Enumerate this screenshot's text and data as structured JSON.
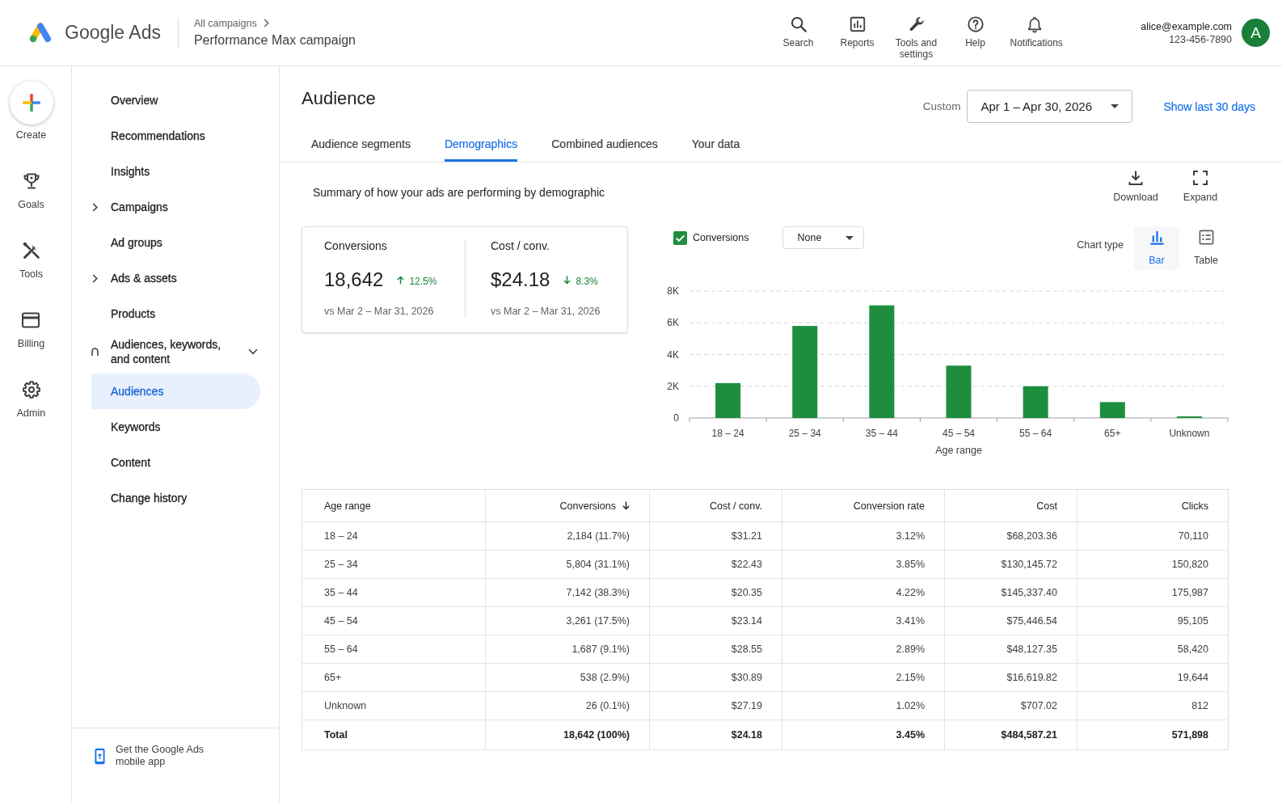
{
  "header": {
    "product_name": "Google Ads",
    "breadcrumb": {
      "parent": "All campaigns",
      "current": "Performance Max campaign"
    },
    "nav": [
      {
        "label": "Search"
      },
      {
        "label": "Reports"
      },
      {
        "label": "Tools and settings"
      },
      {
        "label": "Help"
      },
      {
        "label": "Notifications"
      }
    ],
    "account": {
      "email": "alice@example.com",
      "phone": "123-456-7890",
      "avatar_initial": "A"
    }
  },
  "rail": [
    {
      "label": "Create"
    },
    {
      "label": "Goals"
    },
    {
      "label": "Tools"
    },
    {
      "label": "Billing"
    },
    {
      "label": "Admin"
    }
  ],
  "sidebar": {
    "items": [
      {
        "kind": "link",
        "label": "Overview",
        "selected": false
      },
      {
        "kind": "link",
        "label": "Recommendations",
        "selected": false
      },
      {
        "kind": "link",
        "label": "Insights",
        "selected": false
      },
      {
        "kind": "group",
        "label": "Campaigns",
        "selected": false,
        "expanded": false
      },
      {
        "kind": "link",
        "label": "Ad groups",
        "selected": false
      },
      {
        "kind": "group",
        "label": "Ads & assets",
        "selected": false,
        "expanded": false
      },
      {
        "kind": "link",
        "label": "Products",
        "selected": false
      },
      {
        "kind": "group",
        "label": "Audiences, keywords, and content",
        "selected": false,
        "expanded": true,
        "children": [
          {
            "kind": "link",
            "label": "Audiences",
            "selected": true
          },
          {
            "kind": "link",
            "label": "Keywords",
            "selected": false
          },
          {
            "kind": "link",
            "label": "Content",
            "selected": false
          }
        ]
      },
      {
        "kind": "link",
        "label": "Change history",
        "selected": false
      }
    ],
    "promo": "Get the Google Ads mobile app"
  },
  "page": {
    "title": "Audience",
    "date_range": {
      "label": "Custom",
      "value": "Apr 1 – Apr 30, 2026"
    },
    "quick_range_link": "Show last 30 days",
    "tabs": [
      {
        "label": "Audience segments",
        "selected": false
      },
      {
        "label": "Demographics",
        "selected": true
      },
      {
        "label": "Combined audiences",
        "selected": false
      },
      {
        "label": "Your data",
        "selected": false
      }
    ],
    "summary_text": "Summary of how your ads are performing by demographic",
    "actions": [
      {
        "label": "Download"
      },
      {
        "label": "Expand"
      }
    ],
    "scorecards": [
      {
        "label": "Conversions",
        "value": "18,642",
        "increased": true,
        "change": "12.5%",
        "comparison": "vs Mar 2 – Mar 31, 2026"
      },
      {
        "label": "Cost / conv.",
        "value": "$24.18",
        "increased": false,
        "change": "8.3%",
        "comparison": "vs Mar 2 – Mar 31, 2026"
      }
    ],
    "chart_controls": {
      "metric": {
        "checked": true
      },
      "segment": {
        "value": "None"
      },
      "chart_type": {
        "label": "Chart type",
        "options": [
          {
            "label": "Bar",
            "selected": true
          },
          {
            "label": "Table",
            "selected": false
          }
        ]
      }
    },
    "chart_data": {
      "type": "bar",
      "xlabel": "Age range",
      "categories": [
        "18 – 24",
        "25 – 34",
        "35 – 44",
        "45 – 54",
        "55 – 64",
        "65+",
        "Unknown"
      ],
      "series": [
        {
          "name": "Conversions",
          "color": "#1e8e3e",
          "values": [
            2200,
            5800,
            7100,
            3300,
            2000,
            1000,
            100
          ]
        }
      ],
      "ylim": [
        0,
        8000
      ],
      "yticks": [
        {
          "value": 0,
          "label": "0"
        },
        {
          "value": 2000,
          "label": "2K"
        },
        {
          "value": 4000,
          "label": "4K"
        },
        {
          "value": 6000,
          "label": "6K"
        },
        {
          "value": 8000,
          "label": "8K"
        }
      ],
      "grid": true
    },
    "table": {
      "columns": [
        {
          "label": "Age range",
          "sorted": false
        },
        {
          "label": "Conversions",
          "sorted": true
        },
        {
          "label": "Cost / conv.",
          "sorted": false
        },
        {
          "label": "Conversion rate",
          "sorted": false
        },
        {
          "label": "Cost",
          "sorted": false
        },
        {
          "label": "Clicks",
          "sorted": false
        }
      ],
      "rows": [
        [
          "18 – 24",
          "2,184 (11.7%)",
          "$31.21",
          "3.12%",
          "$68,203.36",
          "70,110"
        ],
        [
          "25 – 34",
          "5,804 (31.1%)",
          "$22.43",
          "3.85%",
          "$130,145.72",
          "150,820"
        ],
        [
          "35 – 44",
          "7,142 (38.3%)",
          "$20.35",
          "4.22%",
          "$145,337.40",
          "175,987"
        ],
        [
          "45 – 54",
          "3,261 (17.5%)",
          "$23.14",
          "3.41%",
          "$75,446.54",
          "95,105"
        ],
        [
          "55 – 64",
          "1,687 (9.1%)",
          "$28.55",
          "2.89%",
          "$48,127.35",
          "58,420"
        ],
        [
          "65+",
          "538 (2.9%)",
          "$30.89",
          "2.15%",
          "$16,619.82",
          "19,644"
        ],
        [
          "Unknown",
          "26 (0.1%)",
          "$27.19",
          "1.02%",
          "$707.02",
          "812"
        ]
      ],
      "total": [
        "Total",
        "18,642 (100%)",
        "$24.18",
        "3.45%",
        "$484,587.21",
        "571,898"
      ]
    }
  }
}
